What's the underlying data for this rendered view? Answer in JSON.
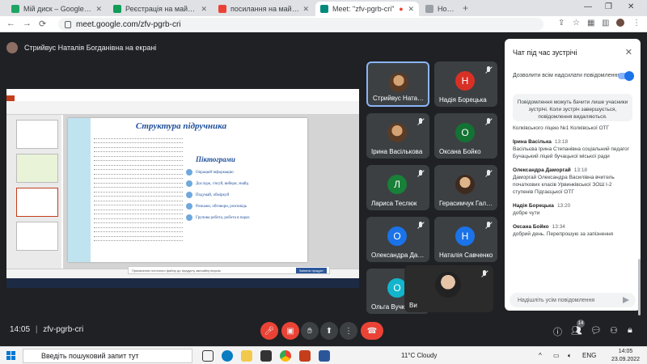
{
  "browser": {
    "tabs": [
      {
        "title": "Мій диск – Google Диск",
        "color": "#1fa463"
      },
      {
        "title": "Реєстрація на майстер-кла",
        "color": "#0f9d58"
      },
      {
        "title": "посилання на майстер-кла",
        "color": "#ea4335"
      },
      {
        "title": "Meet: \"zfv-pgrb-cri\"",
        "color": "#00897b"
      },
      {
        "title": "Нова вкладка",
        "color": "#9aa0a6"
      }
    ],
    "url": "meet.google.com/zfv-pgrb-cri"
  },
  "meet": {
    "presenting_label": "Стрийвус Наталія Богданівна на екрані",
    "meeting_code": "zfv-pgrb-cri",
    "time": "14:05",
    "participant_count": "14",
    "slide": {
      "title": "Структура підручника",
      "pictograms_title": "Піктограми",
      "pictograms": [
        "Опрацюй інформацію",
        "Дослідж, з'ясуй, вибери, знайд",
        "Подумай, обміркуй",
        "Розкажи, обговори, розповідь",
        "Групова робота, робота в парах"
      ],
      "ppt_notice": "Присвоєння поточного файлу до продукту звичайну версію",
      "ppt_notice_button": "Змінити продукт"
    },
    "tiles": [
      {
        "name": "Стрийвус Наталія",
        "avatar": "",
        "color": "",
        "photo": true,
        "selected": true
      },
      {
        "name": "Надія Борецька",
        "avatar": "Н",
        "color": "#d93025"
      },
      {
        "name": "Ірина Васількова",
        "avatar": "",
        "color": "",
        "photo": true
      },
      {
        "name": "Оксана Бойко",
        "avatar": "О",
        "color": "#137333"
      },
      {
        "name": "Лариса Теслюк",
        "avatar": "Л",
        "color": "#188038"
      },
      {
        "name": "Герасимчук Галин...",
        "avatar": "",
        "color": "",
        "photo": true
      },
      {
        "name": "Олександра Дар...",
        "avatar": "О",
        "color": "#1a73e8"
      },
      {
        "name": "Наталія Савченко",
        "avatar": "Н",
        "color": "#1a73e8"
      },
      {
        "name": "Ольга Вучко",
        "avatar": "О",
        "color": "#12b5cb"
      },
      {
        "name": "Ви",
        "avatar": "",
        "color": "",
        "photo": true
      }
    ]
  },
  "chat": {
    "title": "Чат під час зустрічі",
    "toggle_label": "Дозволити всім надсилати повідомлення",
    "note": "Повідомлення можуть бачити лише учасники зустрічі. Коли зустріч завершується, повідомлення видаляються.",
    "messages": [
      {
        "who": "",
        "time": "",
        "text": "Колківського ліцею №1 Колківської ОТГ"
      },
      {
        "who": "Ірина Васілька",
        "time": "13:18",
        "text": "Васільєва Ірина Степанівна соціальний педагог Бучацький ліцей бучацької міської ради"
      },
      {
        "who": "Олександра Даморгай",
        "time": "13:18",
        "text": "Даморгай Олександра Василівна вчитель початкових класів Урвинківської ЗОШ І-2 ступенів Підгаєцької ОТГ"
      },
      {
        "who": "Надія Борецька",
        "time": "13:20",
        "text": "добре чути"
      },
      {
        "who": "Оксана Бойко",
        "time": "13:34",
        "text": "добрий день. Перепрошую за запізнення"
      }
    ],
    "input_placeholder": "Надішліть усім повідомлення"
  },
  "taskbar": {
    "search_placeholder": "Введіть пошуковий запит тут",
    "weather": "11°C  Cloudy",
    "lang": "ENG",
    "clock_time": "14:05",
    "clock_date": "23.09.2022"
  }
}
